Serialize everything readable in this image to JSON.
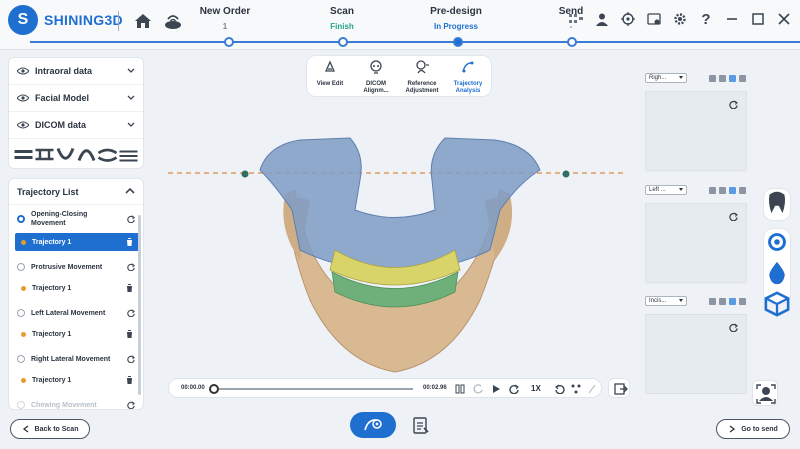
{
  "brand": {
    "name": "SHINING3D",
    "mark": "S"
  },
  "steps": [
    {
      "title": "New Order",
      "status": "1"
    },
    {
      "title": "Scan",
      "status": "Finish"
    },
    {
      "title": "Pre-design",
      "status": "In Progress"
    },
    {
      "title": "Send",
      "status": "-"
    }
  ],
  "left_panel": {
    "items": [
      {
        "label": "Intraoral data"
      },
      {
        "label": "Facial Model"
      },
      {
        "label": "DICOM data"
      }
    ]
  },
  "trajectory": {
    "title": "Trajectory List",
    "movements": [
      {
        "label": "Opening-Closing Movement",
        "trajectory": "Trajectory 1",
        "selected": true
      },
      {
        "label": "Protrusive Movement",
        "trajectory": "Trajectory 1"
      },
      {
        "label": "Left Lateral Movement",
        "trajectory": "Trajectory 1"
      },
      {
        "label": "Right Lateral Movement",
        "trajectory": "Trajectory 1"
      },
      {
        "label": "Chewing Movement"
      }
    ]
  },
  "toolbar": {
    "items": [
      {
        "label": "View Edit"
      },
      {
        "label": "DICOM Alignm..."
      },
      {
        "label": "Reference Adjustment"
      },
      {
        "label": "Trajectory Analysis",
        "active": true
      }
    ]
  },
  "views": [
    {
      "select": "Righ..."
    },
    {
      "select": "Left ..."
    },
    {
      "select": "Incis..."
    }
  ],
  "playback": {
    "current_time": "00:00.00",
    "total_time": "00:02.96",
    "progress": 0,
    "speed": "1X"
  },
  "bottom": {
    "back_label": "Back to Scan",
    "next_label": "Go to send"
  },
  "colors": {
    "accent": "#1f6fd1",
    "finish": "#27a38c",
    "trajectory_dot": "#e59b2e",
    "occlusal_line": "#e08a3c"
  }
}
